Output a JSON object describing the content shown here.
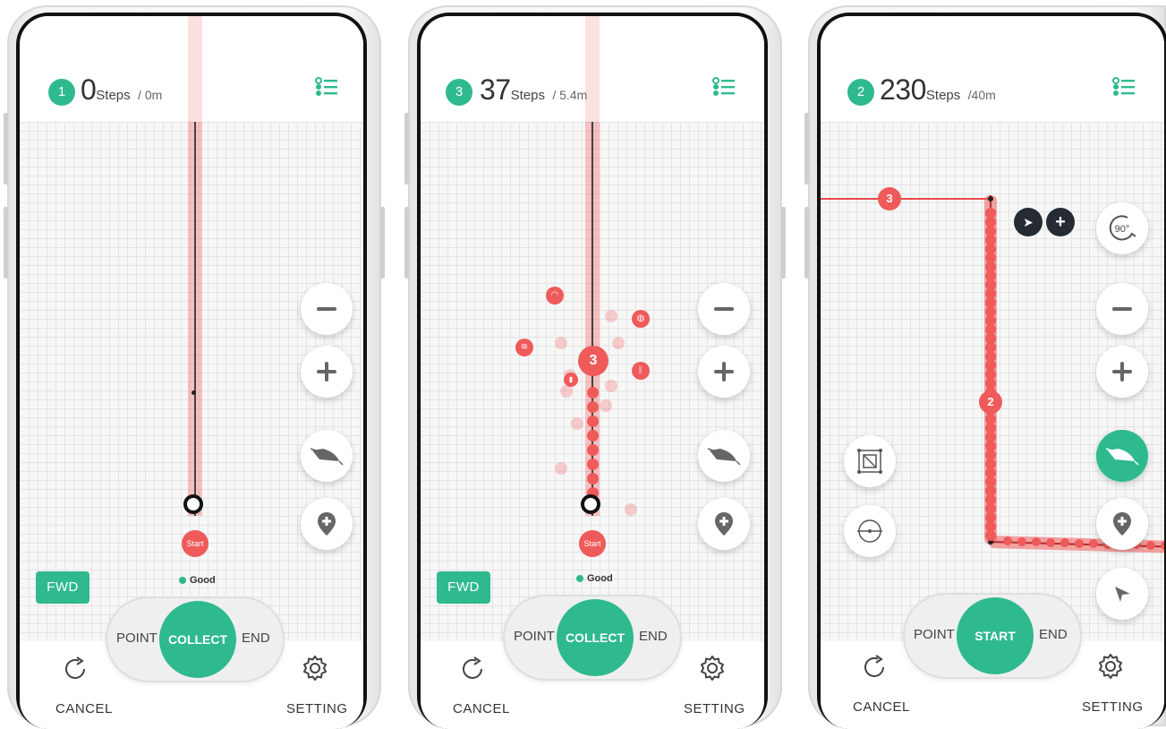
{
  "screens": [
    {
      "badge": "1",
      "steps": "0",
      "steps_unit": "Steps",
      "distance": "/ 0m",
      "fwd_label": "FWD",
      "signal_label": "Good",
      "start_label": "Start",
      "pill": {
        "left": "POINT",
        "center": "COLLECT",
        "right": "END"
      },
      "cancel_label": "CANCEL",
      "setting_label": "SETTING"
    },
    {
      "badge": "3",
      "steps": "37",
      "steps_unit": "Steps",
      "distance": "/ 5.4m",
      "fwd_label": "FWD",
      "signal_label": "Good",
      "start_label": "Start",
      "marker_label": "3",
      "pill": {
        "left": "POINT",
        "center": "COLLECT",
        "right": "END"
      },
      "cancel_label": "CANCEL",
      "setting_label": "SETTING"
    },
    {
      "badge": "2",
      "steps": "230",
      "steps_unit": "Steps",
      "distance": "/40m",
      "marker_top": "3",
      "marker_mid": "2",
      "rotate_label": "90°",
      "pill": {
        "left": "POINT",
        "center": "START",
        "right": "END"
      },
      "cancel_label": "CANCEL",
      "setting_label": "SETTING"
    }
  ],
  "icons": {
    "list": "list-icon",
    "zoom_out": "minus-icon",
    "zoom_in": "plus-icon",
    "direction": "direction-arrow-icon",
    "add_pin": "add-location-pin-icon",
    "navigate": "navigation-arrow-icon",
    "rotate": "rotate-90-icon",
    "refresh": "refresh-icon",
    "gear": "gear-icon"
  },
  "colors": {
    "accent": "#2fb98f",
    "track": "#ef5a5a"
  }
}
